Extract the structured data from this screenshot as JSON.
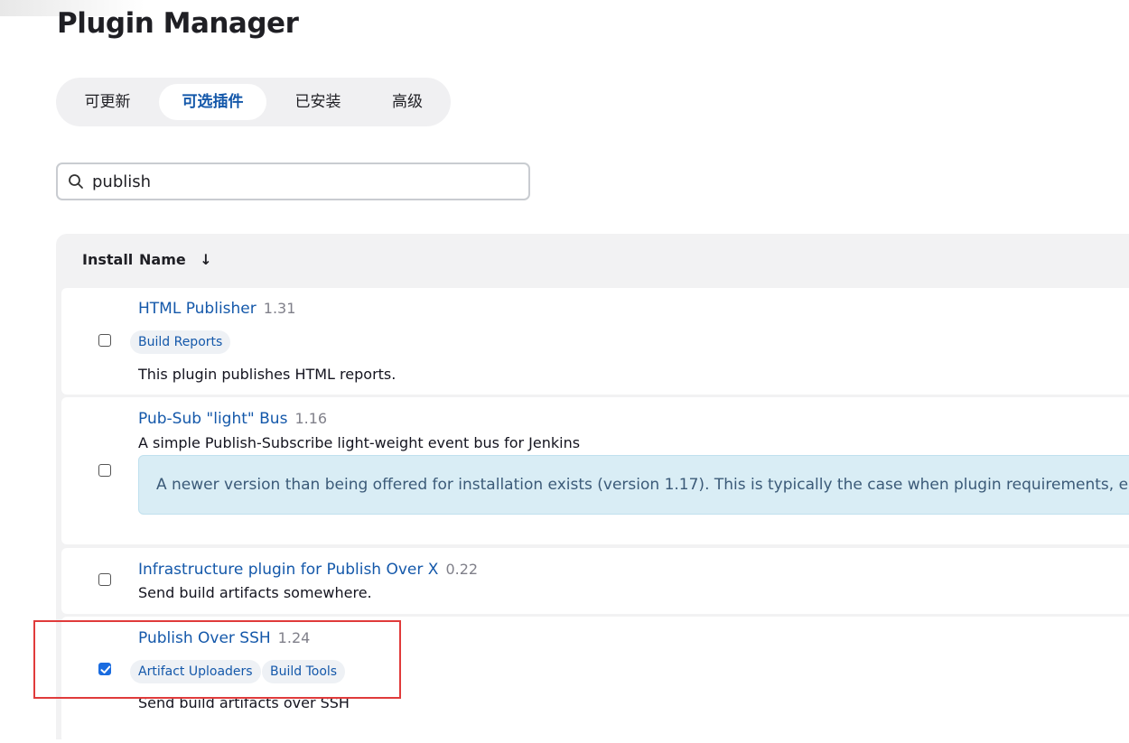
{
  "page": {
    "title": "Plugin Manager"
  },
  "tabs": [
    {
      "label": "可更新",
      "active": false
    },
    {
      "label": "可选插件",
      "active": true
    },
    {
      "label": "已安装",
      "active": false
    },
    {
      "label": "高级",
      "active": false
    }
  ],
  "search": {
    "value": "publish",
    "icon": "search-icon"
  },
  "table": {
    "columns": {
      "install": "Install",
      "name": "Name",
      "sort_indicator": "↓"
    },
    "plugins": [
      {
        "name": "HTML Publisher",
        "version": "1.31",
        "checked": false,
        "tags": [
          "Build Reports"
        ],
        "description": "This plugin publishes HTML reports."
      },
      {
        "name": "Pub-Sub \"light\" Bus",
        "version": "1.16",
        "checked": false,
        "tags": [],
        "description": "A simple Publish-Subscribe light-weight event bus for Jenkins",
        "notice": "A newer version than being offered for installation exists (version 1.17). This is typically the case when plugin requirements, e.g. a recent versi"
      },
      {
        "name": "Infrastructure plugin for Publish Over X",
        "version": "0.22",
        "checked": false,
        "tags": [],
        "description": "Send build artifacts somewhere."
      },
      {
        "name": "Publish Over SSH",
        "version": "1.24",
        "checked": true,
        "tags": [
          "Artifact Uploaders",
          "Build Tools"
        ],
        "description": "Send build artifacts over SSH"
      }
    ]
  },
  "colors": {
    "link": "#1458aa",
    "checkbox_checked": "#1a6ce0",
    "highlight_border": "#e03b3b",
    "notice_bg": "#d9edf5"
  }
}
